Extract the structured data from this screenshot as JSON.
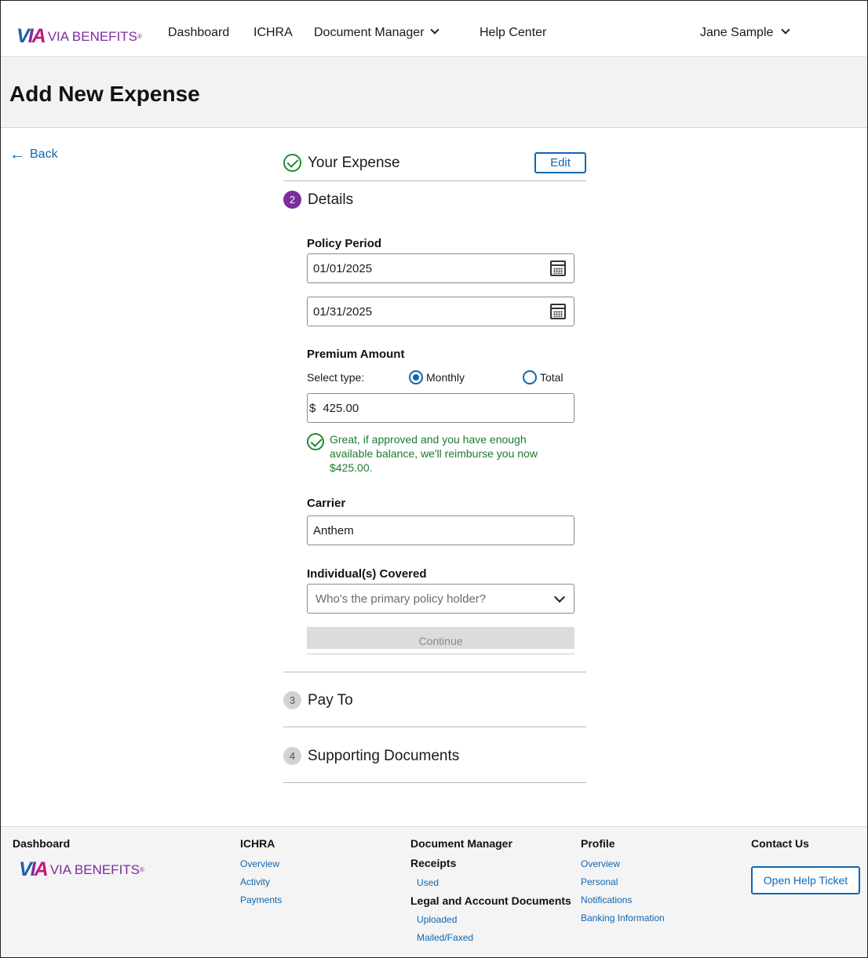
{
  "header": {
    "logo_mark": "VIA",
    "logo_word": "VIA BENEFITS",
    "nav": [
      "Dashboard",
      "ICHRA",
      "Document Manager",
      "Help Center"
    ],
    "user_name": "Jane Sample"
  },
  "page": {
    "title": "Add New Expense",
    "back_label": "Back"
  },
  "steps": {
    "step1_label": "Your Expense",
    "edit_label": "Edit",
    "step2_number": "2",
    "step2_label": "Details",
    "step3_number": "3",
    "step3_label": "Pay To",
    "step4_number": "4",
    "step4_label": "Supporting Documents"
  },
  "form": {
    "policy_period_label": "Policy Period",
    "start_date": "01/01/2025",
    "end_date": "01/31/2025",
    "premium_label": "Premium Amount",
    "select_type_label": "Select type:",
    "radio_monthly": "Monthly",
    "radio_total": "Total",
    "currency_symbol": "$",
    "amount": "425.00",
    "success_message": "Great, if approved and you have enough available balance, we'll reimburse you now $425.00.",
    "carrier_label": "Carrier",
    "carrier_value": "Anthem",
    "covered_label": "Individual(s) Covered",
    "covered_placeholder": "Who's the primary policy holder?",
    "continue_label": "Continue"
  },
  "footer": {
    "col1_head": "Dashboard",
    "col2_head": "ICHRA",
    "col2_links": [
      "Overview",
      "Activity",
      "Payments"
    ],
    "col3_head": "Document Manager",
    "col3_sub1": "Receipts",
    "col3_sub1_links": [
      "Used"
    ],
    "col3_sub2": "Legal and Account Documents",
    "col3_sub2_links": [
      "Uploaded",
      "Mailed/Faxed"
    ],
    "col4_head": "Profile",
    "col4_links": [
      "Overview",
      "Personal",
      "Notifications",
      "Banking Information"
    ],
    "col5_head": "Contact Us",
    "help_button": "Open Help Ticket"
  },
  "colors": {
    "brand_purple": "#7b2e9e",
    "link_blue": "#1066b0",
    "success_green": "#1e8a33"
  }
}
